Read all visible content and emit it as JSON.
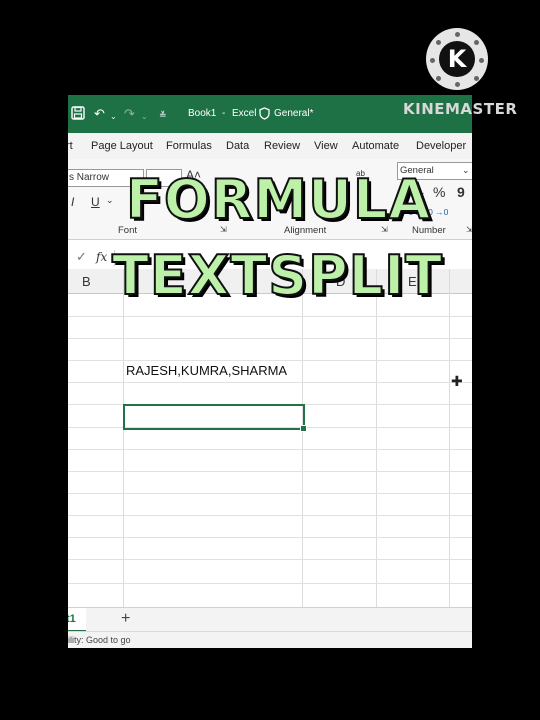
{
  "titlebar": {
    "workbook": "Book1",
    "separator": "-",
    "app": "Excel",
    "sensitivity": "General*"
  },
  "tabs": [
    "rt",
    "Page Layout",
    "Formulas",
    "Data",
    "Review",
    "View",
    "Automate",
    "Developer"
  ],
  "ribbon": {
    "font_name": "s Narrow",
    "italic": "I",
    "underline": "U",
    "font_group": "Font",
    "alignment_group": "Alignment",
    "number_group": "Number",
    "number_format": "General",
    "currency": "$",
    "percent": "%",
    "comma": "9",
    "inc_decimal": "←0 .00",
    "dec_decimal": ".00 →0"
  },
  "formula_bar": {
    "fx": "fx"
  },
  "columns": [
    "B",
    "C",
    "D",
    "E"
  ],
  "cells": {
    "c_text": "RAJESH,KUMRA,SHARMA"
  },
  "sheet": {
    "tab": "t1",
    "add": "+"
  },
  "status": {
    "text": "ility: Good to go"
  },
  "overlay": {
    "line1": "FORMULA",
    "line2": "TEXTSPLIT"
  },
  "watermark": {
    "logo_letter": "K",
    "brand": "KINEMASTER"
  }
}
